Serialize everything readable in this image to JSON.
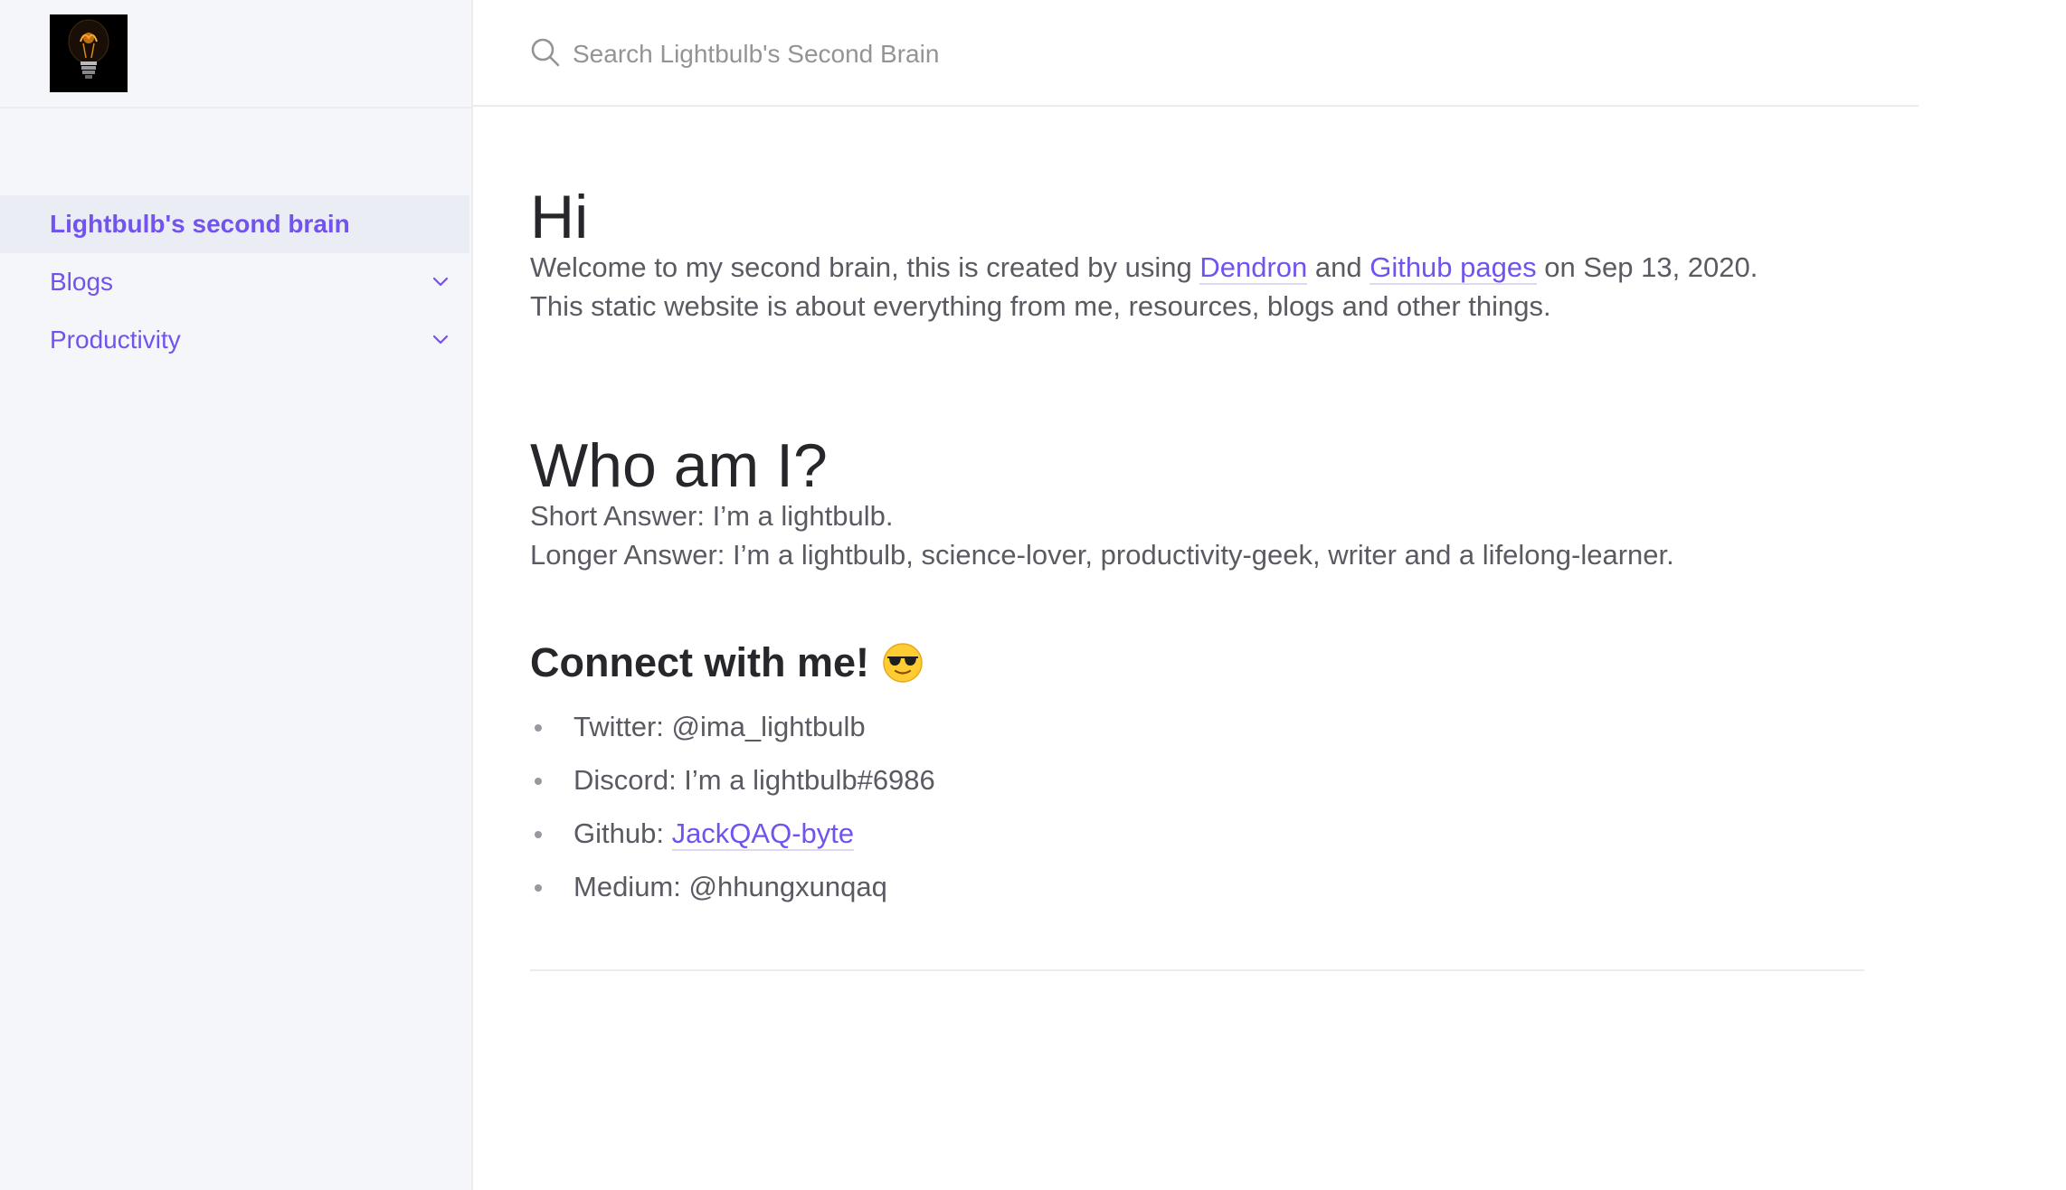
{
  "search": {
    "placeholder": "Search Lightbulb's Second Brain"
  },
  "sidebar": {
    "logo_icon": "lightbulb-icon",
    "items": [
      {
        "label": "Lightbulb's second brain",
        "active": true
      },
      {
        "label": "Blogs",
        "expandable": true
      },
      {
        "label": "Productivity",
        "expandable": true
      }
    ]
  },
  "content": {
    "title": "Hi",
    "intro": {
      "before": "Welcome to my second brain, this is created by using ",
      "link1": "Dendron",
      "middle": " and ",
      "link2": "Github pages",
      "after": " on Sep 13, 2020."
    },
    "about": "This static website is about everything from me, resources, blogs and other things.",
    "who_heading": "Who am I?",
    "short_answer": "Short Answer: I’m a lightbulb.",
    "long_answer": "Longer Answer: I’m a lightbulb, science-lover, productivity-geek, writer and a lifelong-learner.",
    "connect_heading": "Connect with me!",
    "connect_emoji": "sunglasses-emoji-icon",
    "contacts": [
      {
        "text": "Twitter: @ima_lightbulb"
      },
      {
        "text": "Discord: I’m a lightbulb#6986"
      },
      {
        "prefix": "Github: ",
        "link": "JackQAQ-byte"
      },
      {
        "text": "Medium: @hhungxunqaq"
      }
    ]
  },
  "colors": {
    "accent": "#7253ed",
    "sidebar_bg": "#f5f6fa",
    "heading": "#27262b",
    "body_text": "#5c5962"
  }
}
